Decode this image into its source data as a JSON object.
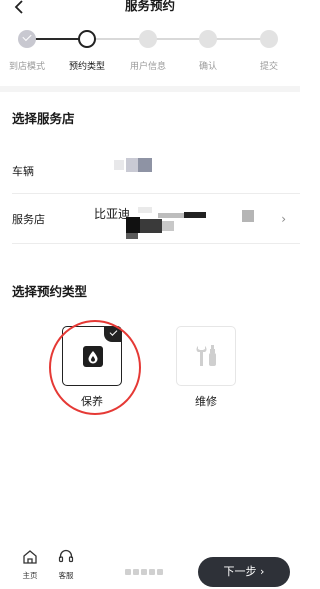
{
  "header": {
    "title": "服务预约"
  },
  "stepper": {
    "steps": [
      {
        "label": "到店模式",
        "state": "done"
      },
      {
        "label": "预约类型",
        "state": "current"
      },
      {
        "label": "用户信息",
        "state": "pending"
      },
      {
        "label": "确认",
        "state": "pending"
      },
      {
        "label": "提交",
        "state": "pending"
      }
    ]
  },
  "store_section": {
    "title": "选择服务店",
    "vehicle_label": "车辆",
    "store_label": "服务店",
    "store_name": "比亚迪"
  },
  "type_section": {
    "title": "选择预约类型",
    "options": [
      {
        "label": "保养",
        "icon": "oil-drop-icon",
        "selected": true
      },
      {
        "label": "维修",
        "icon": "wrench-screwdriver-icon",
        "selected": false
      }
    ]
  },
  "bottom_nav": {
    "home_label": "主页",
    "service_label": "客服",
    "next_label": "下一步"
  },
  "colors": {
    "accent": "#2e3138",
    "highlight_circle": "#e53935"
  }
}
